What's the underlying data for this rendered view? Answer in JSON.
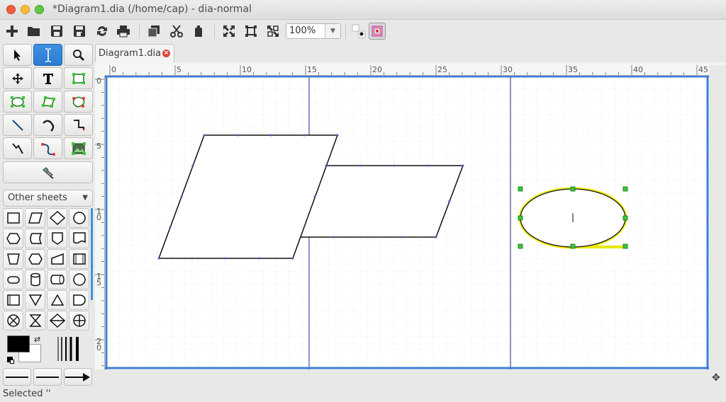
{
  "window": {
    "title": "*Diagram1.dia (/home/cap) - dia-normal"
  },
  "toolbar": {
    "zoom_value": "100%",
    "icons": [
      "new-icon",
      "open-icon",
      "save-icon",
      "save-as-icon",
      "revert-icon",
      "print-icon",
      "copy-icon",
      "cut-icon",
      "paste-icon",
      "best-fit-icon",
      "zoom-fit-icon",
      "fullscreen-icon",
      "snap-grid-icon",
      "object-snap-icon"
    ]
  },
  "tools": {
    "icons": [
      "pointer-icon",
      "text-edit-icon",
      "magnify-icon",
      "scroll-icon",
      "text-icon",
      "box-icon",
      "ellipse-icon",
      "polygon-icon",
      "beziergon-icon",
      "line-icon",
      "arc-icon",
      "zigzag-icon",
      "polyline-icon",
      "bezier-icon",
      "image-icon",
      "outline-icon"
    ]
  },
  "sheets": {
    "selected": "Other sheets"
  },
  "tabs": [
    {
      "label": "Diagram1.dia"
    }
  ],
  "rulers": {
    "horizontal_labels": [
      "0",
      "5",
      "10",
      "15",
      "20",
      "25",
      "30",
      "35",
      "40",
      "45"
    ],
    "vertical_labels": [
      "0",
      "5",
      "10",
      "15",
      "20"
    ]
  },
  "colors": {
    "foreground": "#000000",
    "background": "#ffffff",
    "accent": "#3d8fe0",
    "selection_highlight": "#ffff00",
    "handle": "#33cc33",
    "guide": "#4a4aa8"
  },
  "status": {
    "text": "Selected ''"
  }
}
